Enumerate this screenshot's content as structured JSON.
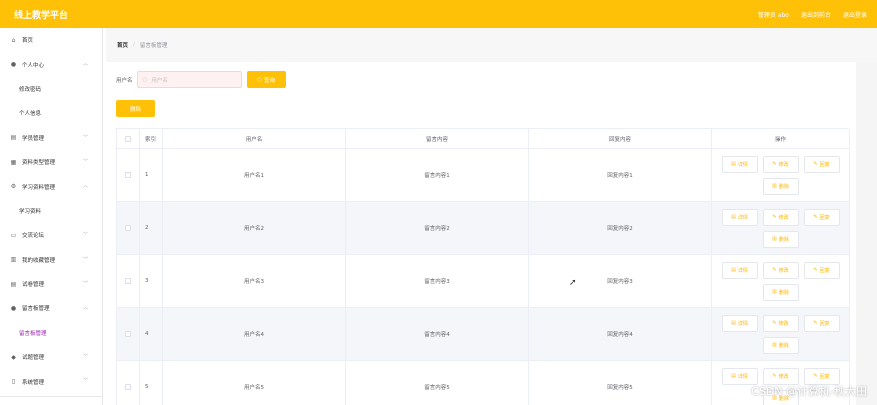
{
  "header": {
    "title": "线上教学平台",
    "links": [
      "管理员 abo",
      "退出到前台",
      "退出登录"
    ]
  },
  "sidebar": {
    "items": [
      {
        "label": "首页",
        "icon": "home-icon",
        "sub": false,
        "arrow": ""
      },
      {
        "label": "个人中心",
        "icon": "user-icon",
        "sub": false,
        "arrow": "︿"
      },
      {
        "label": "修改密码",
        "icon": "",
        "sub": true,
        "arrow": ""
      },
      {
        "label": "个人信息",
        "icon": "",
        "sub": true,
        "arrow": ""
      },
      {
        "label": "学员管理",
        "icon": "folder-icon",
        "sub": false,
        "arrow": "﹀"
      },
      {
        "label": "资料类型管理",
        "icon": "grid-icon",
        "sub": false,
        "arrow": "﹀"
      },
      {
        "label": "学习资料管理",
        "icon": "settings-icon",
        "sub": false,
        "arrow": "︿"
      },
      {
        "label": "学习资料",
        "icon": "",
        "sub": true,
        "arrow": ""
      },
      {
        "label": "交流论坛",
        "icon": "file-icon",
        "sub": false,
        "arrow": "﹀"
      },
      {
        "label": "我的收藏管理",
        "icon": "chart-icon",
        "sub": false,
        "arrow": "﹀"
      },
      {
        "label": "试卷管理",
        "icon": "document-icon",
        "sub": false,
        "arrow": "﹀"
      },
      {
        "label": "留言板管理",
        "icon": "person-icon",
        "sub": false,
        "arrow": "︿"
      },
      {
        "label": "留言板管理",
        "icon": "",
        "sub": true,
        "arrow": "",
        "active": true
      },
      {
        "label": "试题管理",
        "icon": "shield-icon",
        "sub": false,
        "arrow": "﹀"
      },
      {
        "label": "系统管理",
        "icon": "lock-icon",
        "sub": false,
        "arrow": "﹀"
      }
    ]
  },
  "breadcrumb": {
    "home": "首页",
    "separator": "/",
    "current": "留言板管理"
  },
  "search": {
    "label": "用户名",
    "placeholder": "用户名",
    "button": "查询"
  },
  "delete_button": "删除",
  "table": {
    "headers": [
      "索引",
      "用户名",
      "留言内容",
      "回复内容",
      "操作"
    ],
    "rows": [
      {
        "index": "1",
        "user": "用户名1",
        "message": "留言内容1",
        "reply": "回复内容1"
      },
      {
        "index": "2",
        "user": "用户名2",
        "message": "留言内容2",
        "reply": "回复内容2"
      },
      {
        "index": "3",
        "user": "用户名3",
        "message": "留言内容3",
        "reply": "回复内容3"
      },
      {
        "index": "4",
        "user": "用户名4",
        "message": "留言内容4",
        "reply": "回复内容4"
      },
      {
        "index": "5",
        "user": "用户名5",
        "message": "留言内容5",
        "reply": "回复内容5"
      }
    ],
    "actions": [
      "详情",
      "修改",
      "回复",
      "删除"
    ]
  },
  "watermark": "CSDN @计算机-秋大田",
  "colors": {
    "accent": "#ffc107",
    "active_menu": "#9c27b0"
  }
}
